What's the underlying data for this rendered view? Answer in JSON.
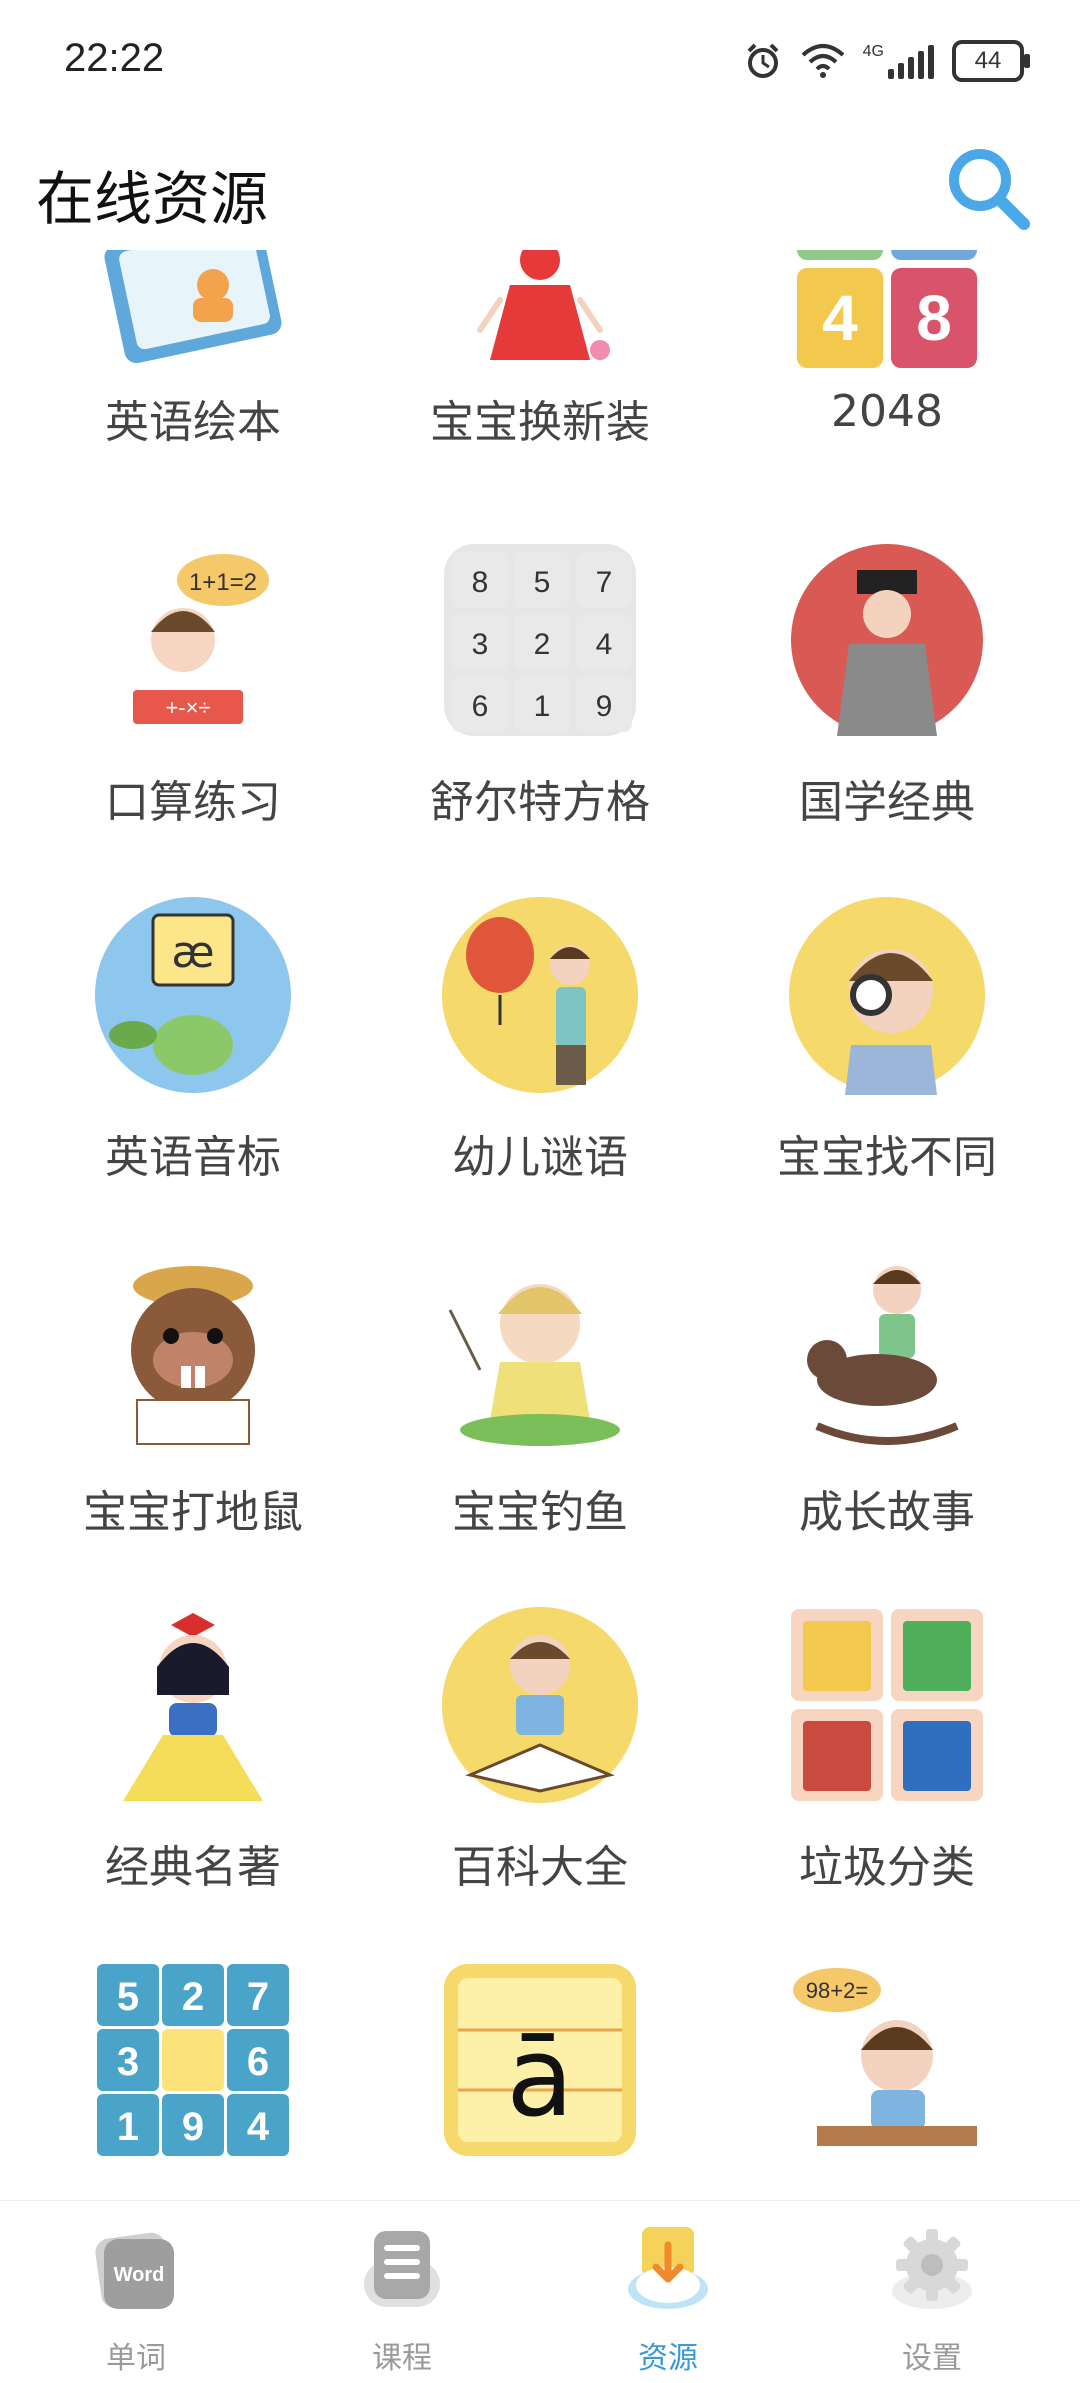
{
  "status_bar": {
    "time": "22:22",
    "network": "4G",
    "battery": "44"
  },
  "header": {
    "title": "在线资源"
  },
  "grid": {
    "items": [
      {
        "label": "英语绘本",
        "icon": "english-picture-book-icon"
      },
      {
        "label": "宝宝换新装",
        "icon": "dress-up-icon"
      },
      {
        "label": "2048",
        "icon": "2048-game-icon"
      },
      {
        "label": "口算练习",
        "icon": "mental-math-icon"
      },
      {
        "label": "舒尔特方格",
        "icon": "schulte-grid-icon"
      },
      {
        "label": "国学经典",
        "icon": "chinese-classics-icon"
      },
      {
        "label": "英语音标",
        "icon": "phonetics-icon"
      },
      {
        "label": "幼儿谜语",
        "icon": "riddles-icon"
      },
      {
        "label": "宝宝找不同",
        "icon": "spot-difference-icon"
      },
      {
        "label": "宝宝打地鼠",
        "icon": "whack-a-mole-icon"
      },
      {
        "label": "宝宝钓鱼",
        "icon": "fishing-icon"
      },
      {
        "label": "成长故事",
        "icon": "growth-stories-icon"
      },
      {
        "label": "经典名著",
        "icon": "classic-literature-icon"
      },
      {
        "label": "百科大全",
        "icon": "encyclopedia-icon"
      },
      {
        "label": "垃圾分类",
        "icon": "garbage-sorting-icon"
      },
      {
        "label": "",
        "icon": "sudoku-icon"
      },
      {
        "label": "",
        "icon": "pinyin-icon"
      },
      {
        "label": "",
        "icon": "math-practice-icon"
      }
    ],
    "schulte_numbers": [
      "8",
      "5",
      "7",
      "3",
      "2",
      "4",
      "6",
      "1",
      "9"
    ],
    "sudoku_numbers": [
      "5",
      "2",
      "7",
      "3",
      "",
      "6",
      "1",
      "9",
      "4"
    ],
    "tile_2048_numbers": [
      "4",
      "8"
    ],
    "phonetic_symbol": "æ",
    "pinyin_symbol": "ā",
    "math_bubble": "1+1=2",
    "math_bubble_2": "98+2=",
    "math_board": "+-×÷"
  },
  "bottom_nav": {
    "items": [
      {
        "label": "单词",
        "icon": "word-card-icon",
        "active": false,
        "badge": "Word"
      },
      {
        "label": "课程",
        "icon": "course-icon",
        "active": false
      },
      {
        "label": "资源",
        "icon": "resource-download-icon",
        "active": true
      },
      {
        "label": "设置",
        "icon": "settings-gear-icon",
        "active": false
      }
    ]
  },
  "colors": {
    "accent": "#3a9ad9",
    "search": "#4aa8e8",
    "text": "#444444",
    "inactive": "#9a9a9a"
  }
}
